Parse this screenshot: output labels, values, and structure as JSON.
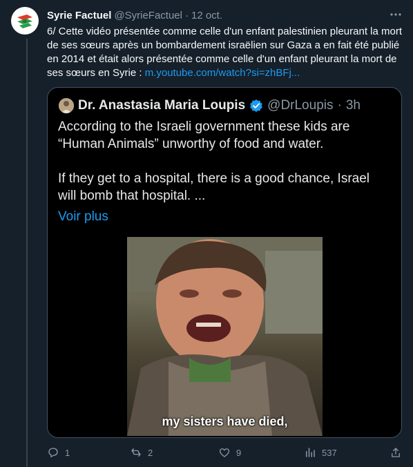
{
  "tweet": {
    "author_name": "Syrie Factuel",
    "handle": "@SyrieFactuel",
    "separator": "·",
    "date": "12 oct.",
    "text": "6/ Cette vidéo présentée comme celle d'un enfant palestinien pleurant la mort de ses sœurs après un bombardement israëlien sur Gaza a en fait été publié en 2014 et était alors présentée comme celle d'un enfant pleurant la mort de ses sœurs en Syrie : ",
    "link": "m.youtube.com/watch?si=zhBFj..."
  },
  "quote": {
    "author_name": "Dr. Anastasia Maria Loupis",
    "handle": "@DrLoupis",
    "separator": "·",
    "time": "3h",
    "line1": "According to the Israeli government these kids are “Human Animals” unworthy of food and water.",
    "line2": "If they get to a hospital, there is a good chance, Israel will bomb that hospital. ...",
    "show_more": "Voir plus",
    "video_caption": "my sisters have died,"
  },
  "actions": {
    "replies": "1",
    "retweets": "2",
    "likes": "9",
    "views": "537"
  },
  "icons": [
    "more-icon",
    "verified-icon",
    "reply-icon",
    "retweet-icon",
    "like-icon",
    "views-icon",
    "share-icon"
  ],
  "colors": {
    "background": "#15202b",
    "link": "#1d9bf0",
    "muted": "#8b98a5",
    "verified": "#1d9bf0"
  }
}
